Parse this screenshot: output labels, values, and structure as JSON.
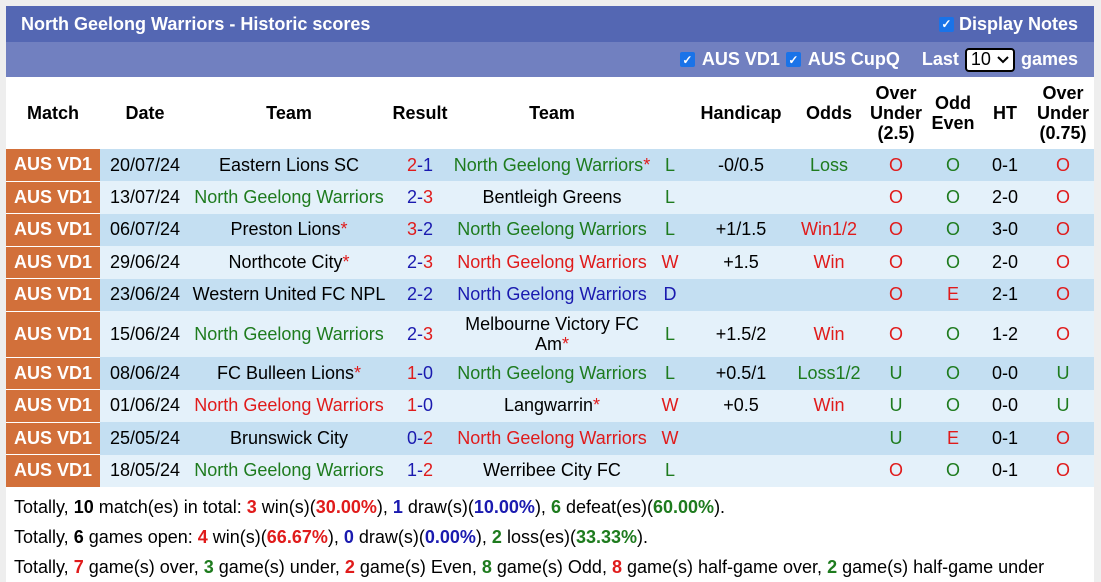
{
  "header": {
    "title": "North Geelong Warriors - Historic scores",
    "display_notes_label": "Display Notes",
    "display_notes_checked": true
  },
  "filters": {
    "leagues": [
      {
        "label": "AUS VD1",
        "checked": true
      },
      {
        "label": "AUS CupQ",
        "checked": true
      }
    ],
    "last_label": "Last",
    "last_value": "10",
    "games_label": "games"
  },
  "columns": [
    "Match",
    "Date",
    "Team",
    "Result",
    "Team",
    "Handicap",
    "Odds",
    "Over Under (2.5)",
    "Odd Even",
    "HT",
    "Over Under (0.75)"
  ],
  "columns_split": {
    "ou25": [
      "Over",
      "Under",
      "(2.5)"
    ],
    "oe": [
      "Odd",
      "Even"
    ],
    "ou075": [
      "Over",
      "Under",
      "(0.75)"
    ]
  },
  "colors": {
    "league_bg": "#d2703a",
    "win": "#e01b1b",
    "loss": "#1e7b1e",
    "draw": "#1a1aaf",
    "header_bg": "#5467b3",
    "filter_bg": "#7180c0"
  },
  "rows": [
    {
      "league": "AUS VD1",
      "date": "20/07/24",
      "home": "Eastern Lions SC",
      "home_color": "black",
      "home_star": false,
      "score_h": "2",
      "score_a": "1",
      "score_h_color": "red",
      "score_a_color": "blue",
      "away": "North Geelong Warriors",
      "away_color": "green",
      "away_star": true,
      "wl": "L",
      "handicap": "-0/0.5",
      "odds": "Loss",
      "odds_color": "green",
      "ou": "O",
      "oe": "O",
      "ht": "0-1",
      "ou2": "O"
    },
    {
      "league": "AUS VD1",
      "date": "13/07/24",
      "home": "North Geelong Warriors",
      "home_color": "green",
      "home_star": false,
      "score_h": "2",
      "score_a": "3",
      "score_h_color": "blue",
      "score_a_color": "red",
      "away": "Bentleigh Greens",
      "away_color": "black",
      "away_star": false,
      "wl": "L",
      "handicap": "",
      "odds": "",
      "odds_color": "black",
      "ou": "O",
      "oe": "O",
      "ht": "2-0",
      "ou2": "O"
    },
    {
      "league": "AUS VD1",
      "date": "06/07/24",
      "home": "Preston Lions",
      "home_color": "black",
      "home_star": true,
      "score_h": "3",
      "score_a": "2",
      "score_h_color": "red",
      "score_a_color": "blue",
      "away": "North Geelong Warriors",
      "away_color": "green",
      "away_star": false,
      "wl": "L",
      "handicap": "+1/1.5",
      "odds": "Win1/2",
      "odds_color": "red",
      "ou": "O",
      "oe": "O",
      "ht": "3-0",
      "ou2": "O"
    },
    {
      "league": "AUS VD1",
      "date": "29/06/24",
      "home": "Northcote City",
      "home_color": "black",
      "home_star": true,
      "score_h": "2",
      "score_a": "3",
      "score_h_color": "blue",
      "score_a_color": "red",
      "away": "North Geelong Warriors",
      "away_color": "red",
      "away_star": false,
      "wl": "W",
      "handicap": "+1.5",
      "odds": "Win",
      "odds_color": "red",
      "ou": "O",
      "oe": "O",
      "ht": "2-0",
      "ou2": "O"
    },
    {
      "league": "AUS VD1",
      "date": "23/06/24",
      "home": "Western United FC NPL",
      "home_color": "black",
      "home_star": false,
      "score_h": "2",
      "score_a": "2",
      "score_h_color": "blue",
      "score_a_color": "blue",
      "away": "North Geelong Warriors",
      "away_color": "blue",
      "away_star": false,
      "wl": "D",
      "handicap": "",
      "odds": "",
      "odds_color": "black",
      "ou": "O",
      "oe": "E",
      "ht": "2-1",
      "ou2": "O"
    },
    {
      "league": "AUS VD1",
      "date": "15/06/24",
      "home": "North Geelong Warriors",
      "home_color": "green",
      "home_star": false,
      "score_h": "2",
      "score_a": "3",
      "score_h_color": "blue",
      "score_a_color": "red",
      "away": "Melbourne Victory FC Am",
      "away_color": "black",
      "away_star": true,
      "wl": "L",
      "handicap": "+1.5/2",
      "odds": "Win",
      "odds_color": "red",
      "ou": "O",
      "oe": "O",
      "ht": "1-2",
      "ou2": "O",
      "tall": true
    },
    {
      "league": "AUS VD1",
      "date": "08/06/24",
      "home": "FC Bulleen Lions",
      "home_color": "black",
      "home_star": true,
      "score_h": "1",
      "score_a": "0",
      "score_h_color": "red",
      "score_a_color": "blue",
      "away": "North Geelong Warriors",
      "away_color": "green",
      "away_star": false,
      "wl": "L",
      "handicap": "+0.5/1",
      "odds": "Loss1/2",
      "odds_color": "green",
      "ou": "U",
      "oe": "O",
      "ht": "0-0",
      "ou2": "U"
    },
    {
      "league": "AUS VD1",
      "date": "01/06/24",
      "home": "North Geelong Warriors",
      "home_color": "red",
      "home_star": false,
      "score_h": "1",
      "score_a": "0",
      "score_h_color": "red",
      "score_a_color": "blue",
      "away": "Langwarrin",
      "away_color": "black",
      "away_star": true,
      "wl": "W",
      "handicap": "+0.5",
      "odds": "Win",
      "odds_color": "red",
      "ou": "U",
      "oe": "O",
      "ht": "0-0",
      "ou2": "U"
    },
    {
      "league": "AUS VD1",
      "date": "25/05/24",
      "home": "Brunswick City",
      "home_color": "black",
      "home_star": false,
      "score_h": "0",
      "score_a": "2",
      "score_h_color": "blue",
      "score_a_color": "red",
      "away": "North Geelong Warriors",
      "away_color": "red",
      "away_star": false,
      "wl": "W",
      "handicap": "",
      "odds": "",
      "odds_color": "black",
      "ou": "U",
      "oe": "E",
      "ht": "0-1",
      "ou2": "O"
    },
    {
      "league": "AUS VD1",
      "date": "18/05/24",
      "home": "North Geelong Warriors",
      "home_color": "green",
      "home_star": false,
      "score_h": "1",
      "score_a": "2",
      "score_h_color": "blue",
      "score_a_color": "red",
      "away": "Werribee City FC",
      "away_color": "black",
      "away_star": false,
      "wl": "L",
      "handicap": "",
      "odds": "",
      "odds_color": "black",
      "ou": "O",
      "oe": "O",
      "ht": "0-1",
      "ou2": "O"
    }
  ],
  "summary": [
    [
      {
        "t": "Totally, "
      },
      {
        "t": "10",
        "c": "k"
      },
      {
        "t": " match(es) in total: "
      },
      {
        "t": "3",
        "c": "r"
      },
      {
        "t": " win(s)("
      },
      {
        "t": "30.00%",
        "c": "r"
      },
      {
        "t": "), "
      },
      {
        "t": "1",
        "c": "b"
      },
      {
        "t": " draw(s)("
      },
      {
        "t": "10.00%",
        "c": "b"
      },
      {
        "t": "), "
      },
      {
        "t": "6",
        "c": "g"
      },
      {
        "t": " defeat(es)("
      },
      {
        "t": "60.00%",
        "c": "g"
      },
      {
        "t": ")."
      }
    ],
    [
      {
        "t": "Totally, "
      },
      {
        "t": "6",
        "c": "k"
      },
      {
        "t": " games open: "
      },
      {
        "t": "4",
        "c": "r"
      },
      {
        "t": " win(s)("
      },
      {
        "t": "66.67%",
        "c": "r"
      },
      {
        "t": "), "
      },
      {
        "t": "0",
        "c": "b"
      },
      {
        "t": " draw(s)("
      },
      {
        "t": "0.00%",
        "c": "b"
      },
      {
        "t": "), "
      },
      {
        "t": "2",
        "c": "g"
      },
      {
        "t": " loss(es)("
      },
      {
        "t": "33.33%",
        "c": "g"
      },
      {
        "t": ")."
      }
    ],
    [
      {
        "t": "Totally, "
      },
      {
        "t": "7",
        "c": "r"
      },
      {
        "t": " game(s) over, "
      },
      {
        "t": "3",
        "c": "g"
      },
      {
        "t": " game(s) under, "
      },
      {
        "t": "2",
        "c": "r"
      },
      {
        "t": " game(s) Even, "
      },
      {
        "t": "8",
        "c": "g"
      },
      {
        "t": " game(s) Odd, "
      },
      {
        "t": "8",
        "c": "r"
      },
      {
        "t": " game(s) half-game over, "
      },
      {
        "t": "2",
        "c": "g"
      },
      {
        "t": " game(s) half-game under"
      }
    ]
  ]
}
